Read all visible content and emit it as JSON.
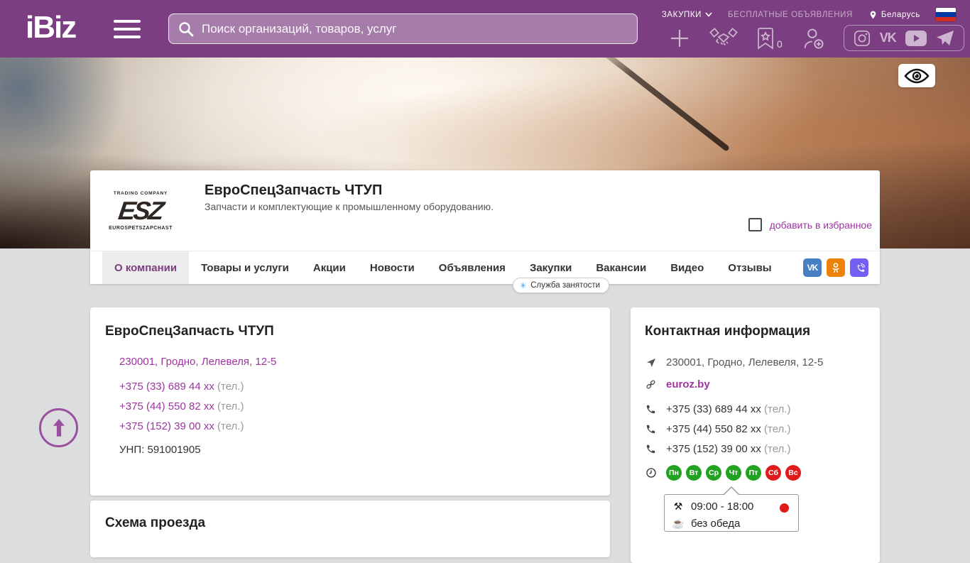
{
  "header": {
    "logo": "iBiz",
    "search_placeholder": "Поиск организаций, товаров, услуг",
    "links": {
      "zakupki": "ЗАКУПКИ",
      "free_ads": "БЕСПЛАТНЫЕ ОБЪЯВЛЕНИЯ",
      "country": "Беларусь"
    },
    "favorites_count": "0"
  },
  "icons": {
    "menu": "hamburger",
    "search": "magnifier",
    "add": "plus",
    "partners": "handshake",
    "favorites": "bookmark-star",
    "register": "person-add",
    "instagram": "camera-square",
    "vk_text": "VK",
    "youtube": "play-button",
    "telegram": "paper-plane",
    "views": "eye",
    "location": "map-pin",
    "address": "navigation-arrow",
    "website": "chain-link",
    "phone": "handset",
    "hours": "clock",
    "work_time": "⚒",
    "lunch": "☕",
    "tooltip_star": "✳"
  },
  "company": {
    "name": "ЕвроСпецЗапчасть ЧТУП",
    "description": "Запчасти и комплектующие к промышленному оборудованию.",
    "logo": {
      "top": "TRADING COMPANY",
      "abbr": "ESZ",
      "bottom": "EUROSPETSZAPCHAST"
    },
    "favorite_label": "добавить в избранное"
  },
  "tabs": [
    {
      "label": "О компании",
      "active": true
    },
    {
      "label": "Товары и услуги",
      "active": false
    },
    {
      "label": "Акции",
      "active": false
    },
    {
      "label": "Новости",
      "active": false
    },
    {
      "label": "Объявления",
      "active": false
    },
    {
      "label": "Закупки",
      "active": false
    },
    {
      "label": "Вакансии",
      "active": false
    },
    {
      "label": "Видео",
      "active": false
    },
    {
      "label": "Отзывы",
      "active": false
    }
  ],
  "tooltip": {
    "label": "Служба занятости"
  },
  "about": {
    "title": "ЕвроСпецЗапчасть ЧТУП",
    "address": "230001, Гродно, Лелевеля, 12-5",
    "phones": [
      {
        "number": "+375 (33) 689 44 xx",
        "suffix": "(тел.)"
      },
      {
        "number": "+375 (44) 550 82 xx",
        "suffix": "(тел.)"
      },
      {
        "number": "+375 (152) 39 00 xx",
        "suffix": "(тел.)"
      }
    ],
    "unp": "УНП: 591001905"
  },
  "map_section": {
    "title": "Схема проезда"
  },
  "contact": {
    "title": "Контактная информация",
    "address": "230001, Гродно, Лелевеля, 12-5",
    "website": "euroz.by",
    "phones": [
      {
        "number": "+375 (33) 689 44 xx",
        "suffix": "(тел.)"
      },
      {
        "number": "+375 (44) 550 82 xx",
        "suffix": "(тел.)"
      },
      {
        "number": "+375 (152) 39 00 xx",
        "suffix": "(тел.)"
      }
    ],
    "days": [
      {
        "label": "Пн",
        "status": "open"
      },
      {
        "label": "Вт",
        "status": "open"
      },
      {
        "label": "Ср",
        "status": "open"
      },
      {
        "label": "Чт",
        "status": "open"
      },
      {
        "label": "Пт",
        "status": "open"
      },
      {
        "label": "Сб",
        "status": "closed"
      },
      {
        "label": "Вс",
        "status": "closed"
      }
    ],
    "hours": {
      "time": "09:00 - 18:00",
      "lunch": "без обеда"
    }
  },
  "colors": {
    "header_bg": "#7B3E80",
    "accent_purple": "#9C35A0",
    "tab_active": "#7B3E7F",
    "day_open": "#21A321",
    "day_closed": "#E01A1A",
    "vk_blue": "#4680C2",
    "ok_orange": "#EE8208",
    "viber_purple": "#7360F2"
  }
}
